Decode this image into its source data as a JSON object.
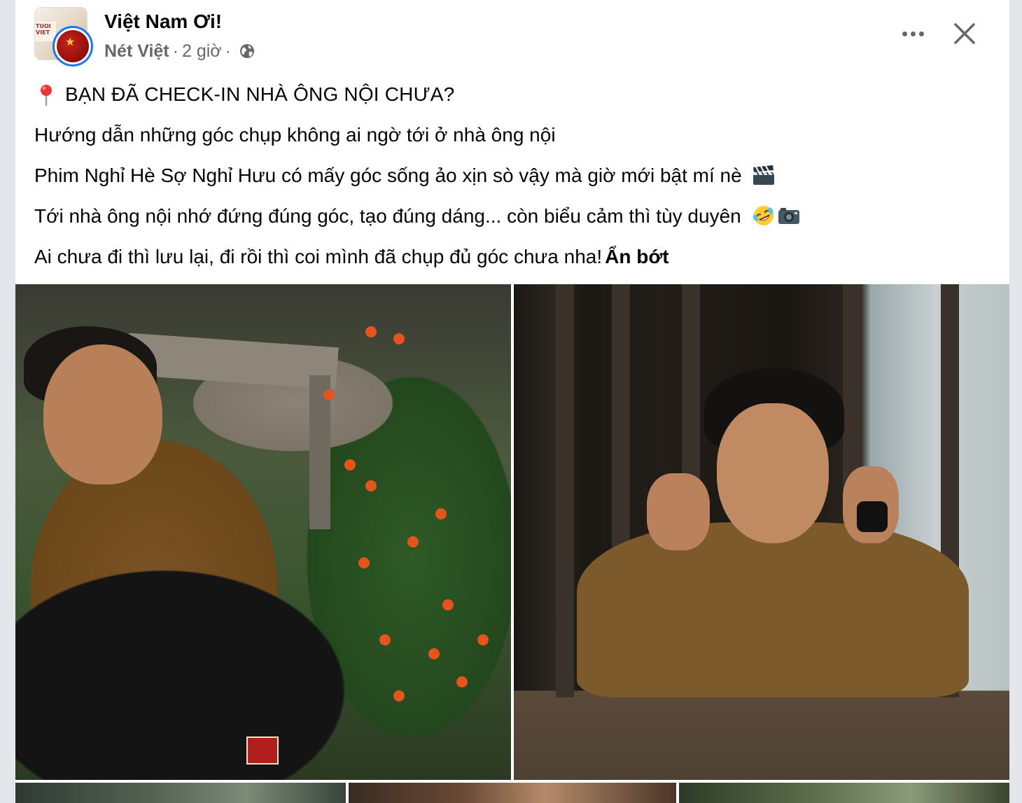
{
  "post": {
    "group_name": "Việt Nam Ơi!",
    "author": "Nét Việt",
    "separator": "·",
    "time": "2 giờ",
    "privacy_icon": "globe-icon",
    "more_icon": "more-horizontal-icon",
    "close_icon": "close-icon",
    "body": {
      "headline": "BẠN ĐÃ CHECK-IN NHÀ ÔNG NỘI CHƯA?",
      "line_1": "Hướng dẫn những góc chụp không ai ngờ tới ở nhà ông nội",
      "line_2": "Phim Nghỉ Hè Sợ Nghỉ Hưu có mấy góc sống ảo xịn sò vậy mà giờ mới bật mí nè",
      "line_3": "Tới nhà ông nội nhớ đứng đúng góc, tạo đúng dáng... còn biểu cảm thì tùy duyên",
      "line_4": "Ai chưa đi thì lưu lại, đi rồi thì coi mình đã chụp đủ góc chưa nha!",
      "see_less": "Ẩn bớt"
    },
    "icons": {
      "headline": "round-pushpin-icon",
      "line_2": "clapper-board-icon",
      "line_3": [
        "rolling-laughing-icon",
        "camera-icon"
      ]
    },
    "photos": [
      {
        "name": "photo-man-crouching-flowers"
      },
      {
        "name": "photo-man-wooden-window"
      },
      {
        "name": "photo-thumb-3"
      },
      {
        "name": "photo-thumb-4"
      },
      {
        "name": "photo-thumb-5"
      }
    ],
    "colors": {
      "link_blue": "#1877f2",
      "secondary_text": "#65676b",
      "primary_text": "#050505"
    }
  }
}
